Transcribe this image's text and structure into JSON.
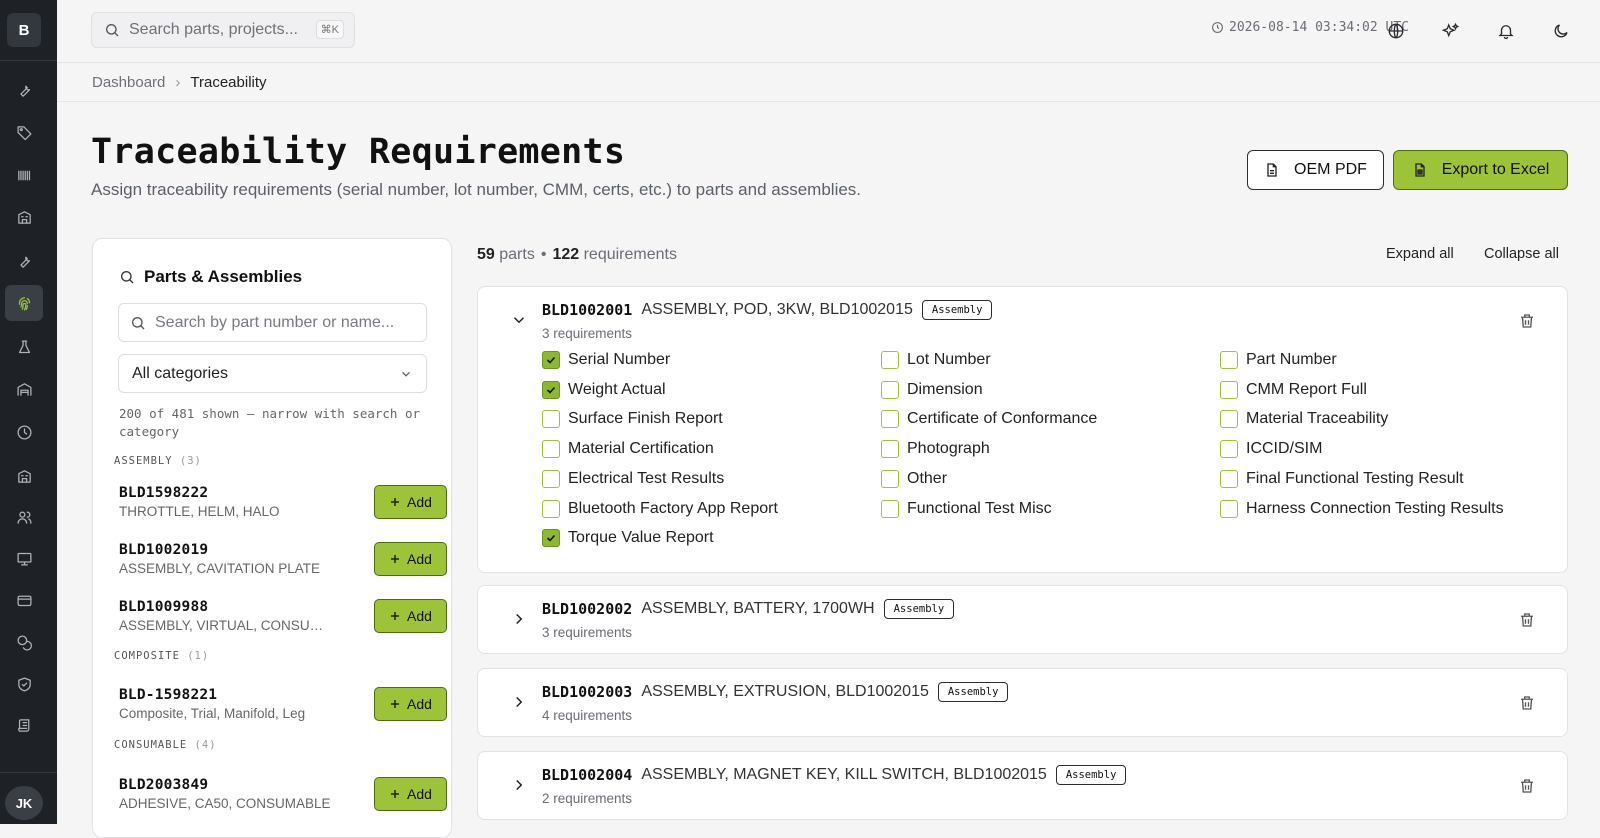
{
  "sidebar": {
    "logo": "B",
    "avatar": "JK",
    "items": [
      {
        "icon": "wrench-icon"
      },
      {
        "icon": "tag-icon"
      },
      {
        "icon": "barcode-icon"
      },
      {
        "icon": "building-icon"
      },
      {
        "icon": "wrench-icon"
      },
      {
        "icon": "fingerprint-icon",
        "active": true
      },
      {
        "icon": "flask-icon"
      },
      {
        "icon": "warehouse-icon"
      },
      {
        "icon": "clock-icon"
      },
      {
        "icon": "building-icon"
      },
      {
        "icon": "users-icon"
      },
      {
        "icon": "monitor-icon"
      },
      {
        "icon": "credit-card-icon"
      },
      {
        "icon": "coins-icon"
      },
      {
        "icon": "shield-check-icon"
      },
      {
        "icon": "scroll-icon"
      }
    ]
  },
  "topbar": {
    "search_placeholder": "Search parts, projects...",
    "shortcut": "⌘K",
    "clock": "2026-08-14 03:34:02 UTC"
  },
  "breadcrumb": {
    "home": "Dashboard",
    "current": "Traceability"
  },
  "header": {
    "title": "Traceability Requirements",
    "subtitle": "Assign traceability requirements (serial number, lot number, CMM, certs, etc.) to parts and assemblies.",
    "oem_pdf": "OEM PDF",
    "export": "Export to Excel"
  },
  "left_panel": {
    "title": "Parts & Assemblies",
    "search_placeholder": "Search by part number or name...",
    "category": "All categories",
    "note": "200 of 481 shown — narrow with search or category",
    "add_label": "Add",
    "groups": [
      {
        "name": "ASSEMBLY",
        "count": "(3)",
        "parts": [
          {
            "number": "BLD1598222",
            "desc": "THROTTLE, HELM, HALO"
          },
          {
            "number": "BLD1002019",
            "desc": "ASSEMBLY, CAVITATION PLATE"
          },
          {
            "number": "BLD1009988",
            "desc": "ASSEMBLY, VIRTUAL, CONSUMABLE"
          }
        ]
      },
      {
        "name": "COMPOSITE",
        "count": "(1)",
        "parts": [
          {
            "number": "BLD-1598221",
            "desc": "Composite, Trial, Manifold, Leg"
          }
        ]
      },
      {
        "name": "CONSUMABLE",
        "count": "(4)",
        "parts": [
          {
            "number": "BLD2003849",
            "desc": "ADHESIVE, CA50, CONSUMABLE"
          }
        ]
      }
    ]
  },
  "summary": {
    "parts": "59",
    "parts_label": "parts",
    "reqs": "122",
    "reqs_label": "requirements",
    "expand_all": "Expand all",
    "collapse_all": "Collapse all"
  },
  "cards": [
    {
      "number": "BLD1002001",
      "name": "ASSEMBLY, POD, 3KW, BLD1002015",
      "badge": "Assembly",
      "reqs": "3 requirements",
      "expanded": true
    },
    {
      "number": "BLD1002002",
      "name": "ASSEMBLY, BATTERY, 1700WH",
      "badge": "Assembly",
      "reqs": "3 requirements",
      "expanded": false
    },
    {
      "number": "BLD1002003",
      "name": "ASSEMBLY, EXTRUSION, BLD1002015",
      "badge": "Assembly",
      "reqs": "4 requirements",
      "expanded": false
    },
    {
      "number": "BLD1002004",
      "name": "ASSEMBLY, MAGNET KEY, KILL SWITCH, BLD1002015",
      "badge": "Assembly",
      "reqs": "2 requirements",
      "expanded": false
    }
  ],
  "requirements": [
    {
      "label": "Serial Number",
      "checked": true
    },
    {
      "label": "Lot Number",
      "checked": false
    },
    {
      "label": "Part Number",
      "checked": false
    },
    {
      "label": "Weight Actual",
      "checked": true
    },
    {
      "label": "Dimension",
      "checked": false
    },
    {
      "label": "CMM Report Full",
      "checked": false
    },
    {
      "label": "Surface Finish Report",
      "checked": false
    },
    {
      "label": "Certificate of Conformance",
      "checked": false
    },
    {
      "label": "Material Traceability",
      "checked": false
    },
    {
      "label": "Material Certification",
      "checked": false
    },
    {
      "label": "Photograph",
      "checked": false
    },
    {
      "label": "ICCID/SIM",
      "checked": false
    },
    {
      "label": "Electrical Test Results",
      "checked": false
    },
    {
      "label": "Other",
      "checked": false
    },
    {
      "label": "Final Functional Testing Result",
      "checked": false
    },
    {
      "label": "Bluetooth Factory App Report",
      "checked": false
    },
    {
      "label": "Functional Test Misc",
      "checked": false
    },
    {
      "label": "Harness Connection Testing Results",
      "checked": false
    },
    {
      "label": "Torque Value Report",
      "checked": true
    }
  ],
  "colors": {
    "accent": "#9dc438",
    "sidebar": "#1e2226",
    "background": "#f5f5f6"
  }
}
